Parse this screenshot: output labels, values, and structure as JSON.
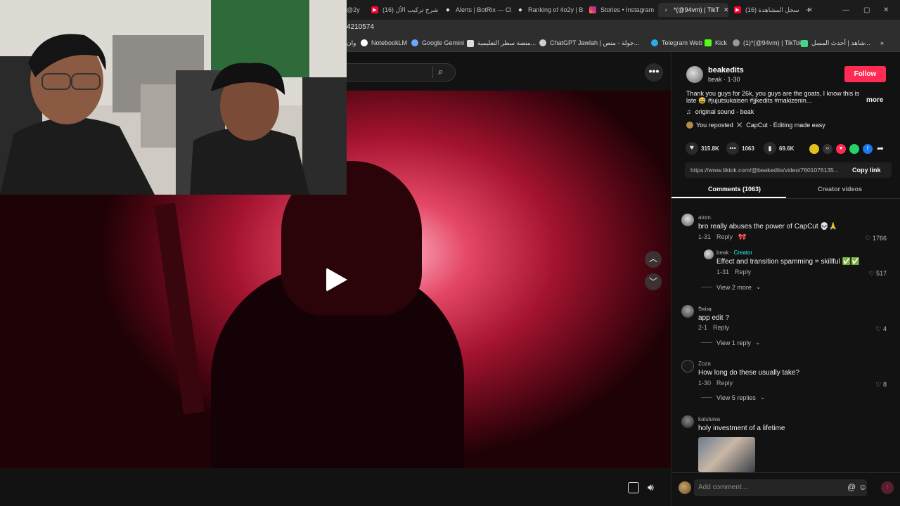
{
  "browser": {
    "tabs": [
      {
        "title": "@2y",
        "icon": "tab-icon"
      },
      {
        "title": "شرح تركيب الأل (16)",
        "icon": "youtube-icon"
      },
      {
        "title": "Alerts | BotRix — Cl",
        "icon": "diamond-icon"
      },
      {
        "title": "Ranking of 4o2y | B",
        "icon": "diamond-icon"
      },
      {
        "title": "Stories • Instagram",
        "icon": "instagram-icon"
      },
      {
        "title": "*(@94vm) | TikT",
        "icon": "tiktok-icon"
      },
      {
        "title": "سجل المشاهدة (16)",
        "icon": "youtube-icon"
      }
    ],
    "url": "4210574",
    "bookmarks": [
      {
        "label": "وان"
      },
      {
        "label": "NotebookLM"
      },
      {
        "label": "Google Gemini"
      },
      {
        "label": "منصة سطر التعليمية..."
      },
      {
        "label": "ChatGPT"
      },
      {
        "label": "Jawlah | جولة - منص..."
      },
      {
        "label": "Telegram Web"
      },
      {
        "label": "Kick"
      },
      {
        "label": "(1)*(@94vm) | TikTok"
      },
      {
        "label": "شاهد | أحدث المسل..."
      }
    ]
  },
  "post": {
    "author": "beakedits",
    "subtitle": "beak · 1-30",
    "follow_label": "Follow",
    "caption_line1": "Thank you guys for 26k, you guys are the goats, I know this is",
    "caption_line2": "late 😅 #jujutsukaisen #jjkedits #makizenin...",
    "more_label": "more",
    "sound": "original sound - beak",
    "reposted": "You reposted",
    "capcut": "CapCut · Editing made easy",
    "likes": "315.8K",
    "comments": "1063",
    "saves": "69.6K",
    "link": "https://www.tiktok.com/@beakedits/video/7601076135...",
    "copy_link": "Copy link",
    "tab_comments": "Comments (1063)",
    "tab_creator": "Creator videos"
  },
  "comments": [
    {
      "user": "atom.",
      "text": "bro really abuses the power of CapCut 💀🙏",
      "date": "1-31",
      "reply": "Reply",
      "likes": "1766"
    },
    {
      "user": "beak",
      "creator_tag": "Creator",
      "text": "Effect and transition spamming = skillful ✅✅",
      "date": "1-31",
      "reply": "Reply",
      "likes": "517"
    },
    {
      "view_more": "View 2 more"
    },
    {
      "user": "𝕯𝖆𝖎𝖘𝖞",
      "text": "app edit ?",
      "date": "2-1",
      "reply": "Reply",
      "likes": "4"
    },
    {
      "view_more": "View 1 reply"
    },
    {
      "user": "Zoza",
      "text": "How long do these usually take?",
      "date": "1-30",
      "reply": "Reply",
      "likes": "8"
    },
    {
      "view_more": "View 5 replies"
    },
    {
      "user": "kaluluwa",
      "text": "holy investment of a lifetime"
    }
  ],
  "add_comment_placeholder": "Add comment...",
  "colors": {
    "follow": "#fe2c55",
    "accent": "#25f4ee",
    "tiktok_bg": "#121212"
  }
}
